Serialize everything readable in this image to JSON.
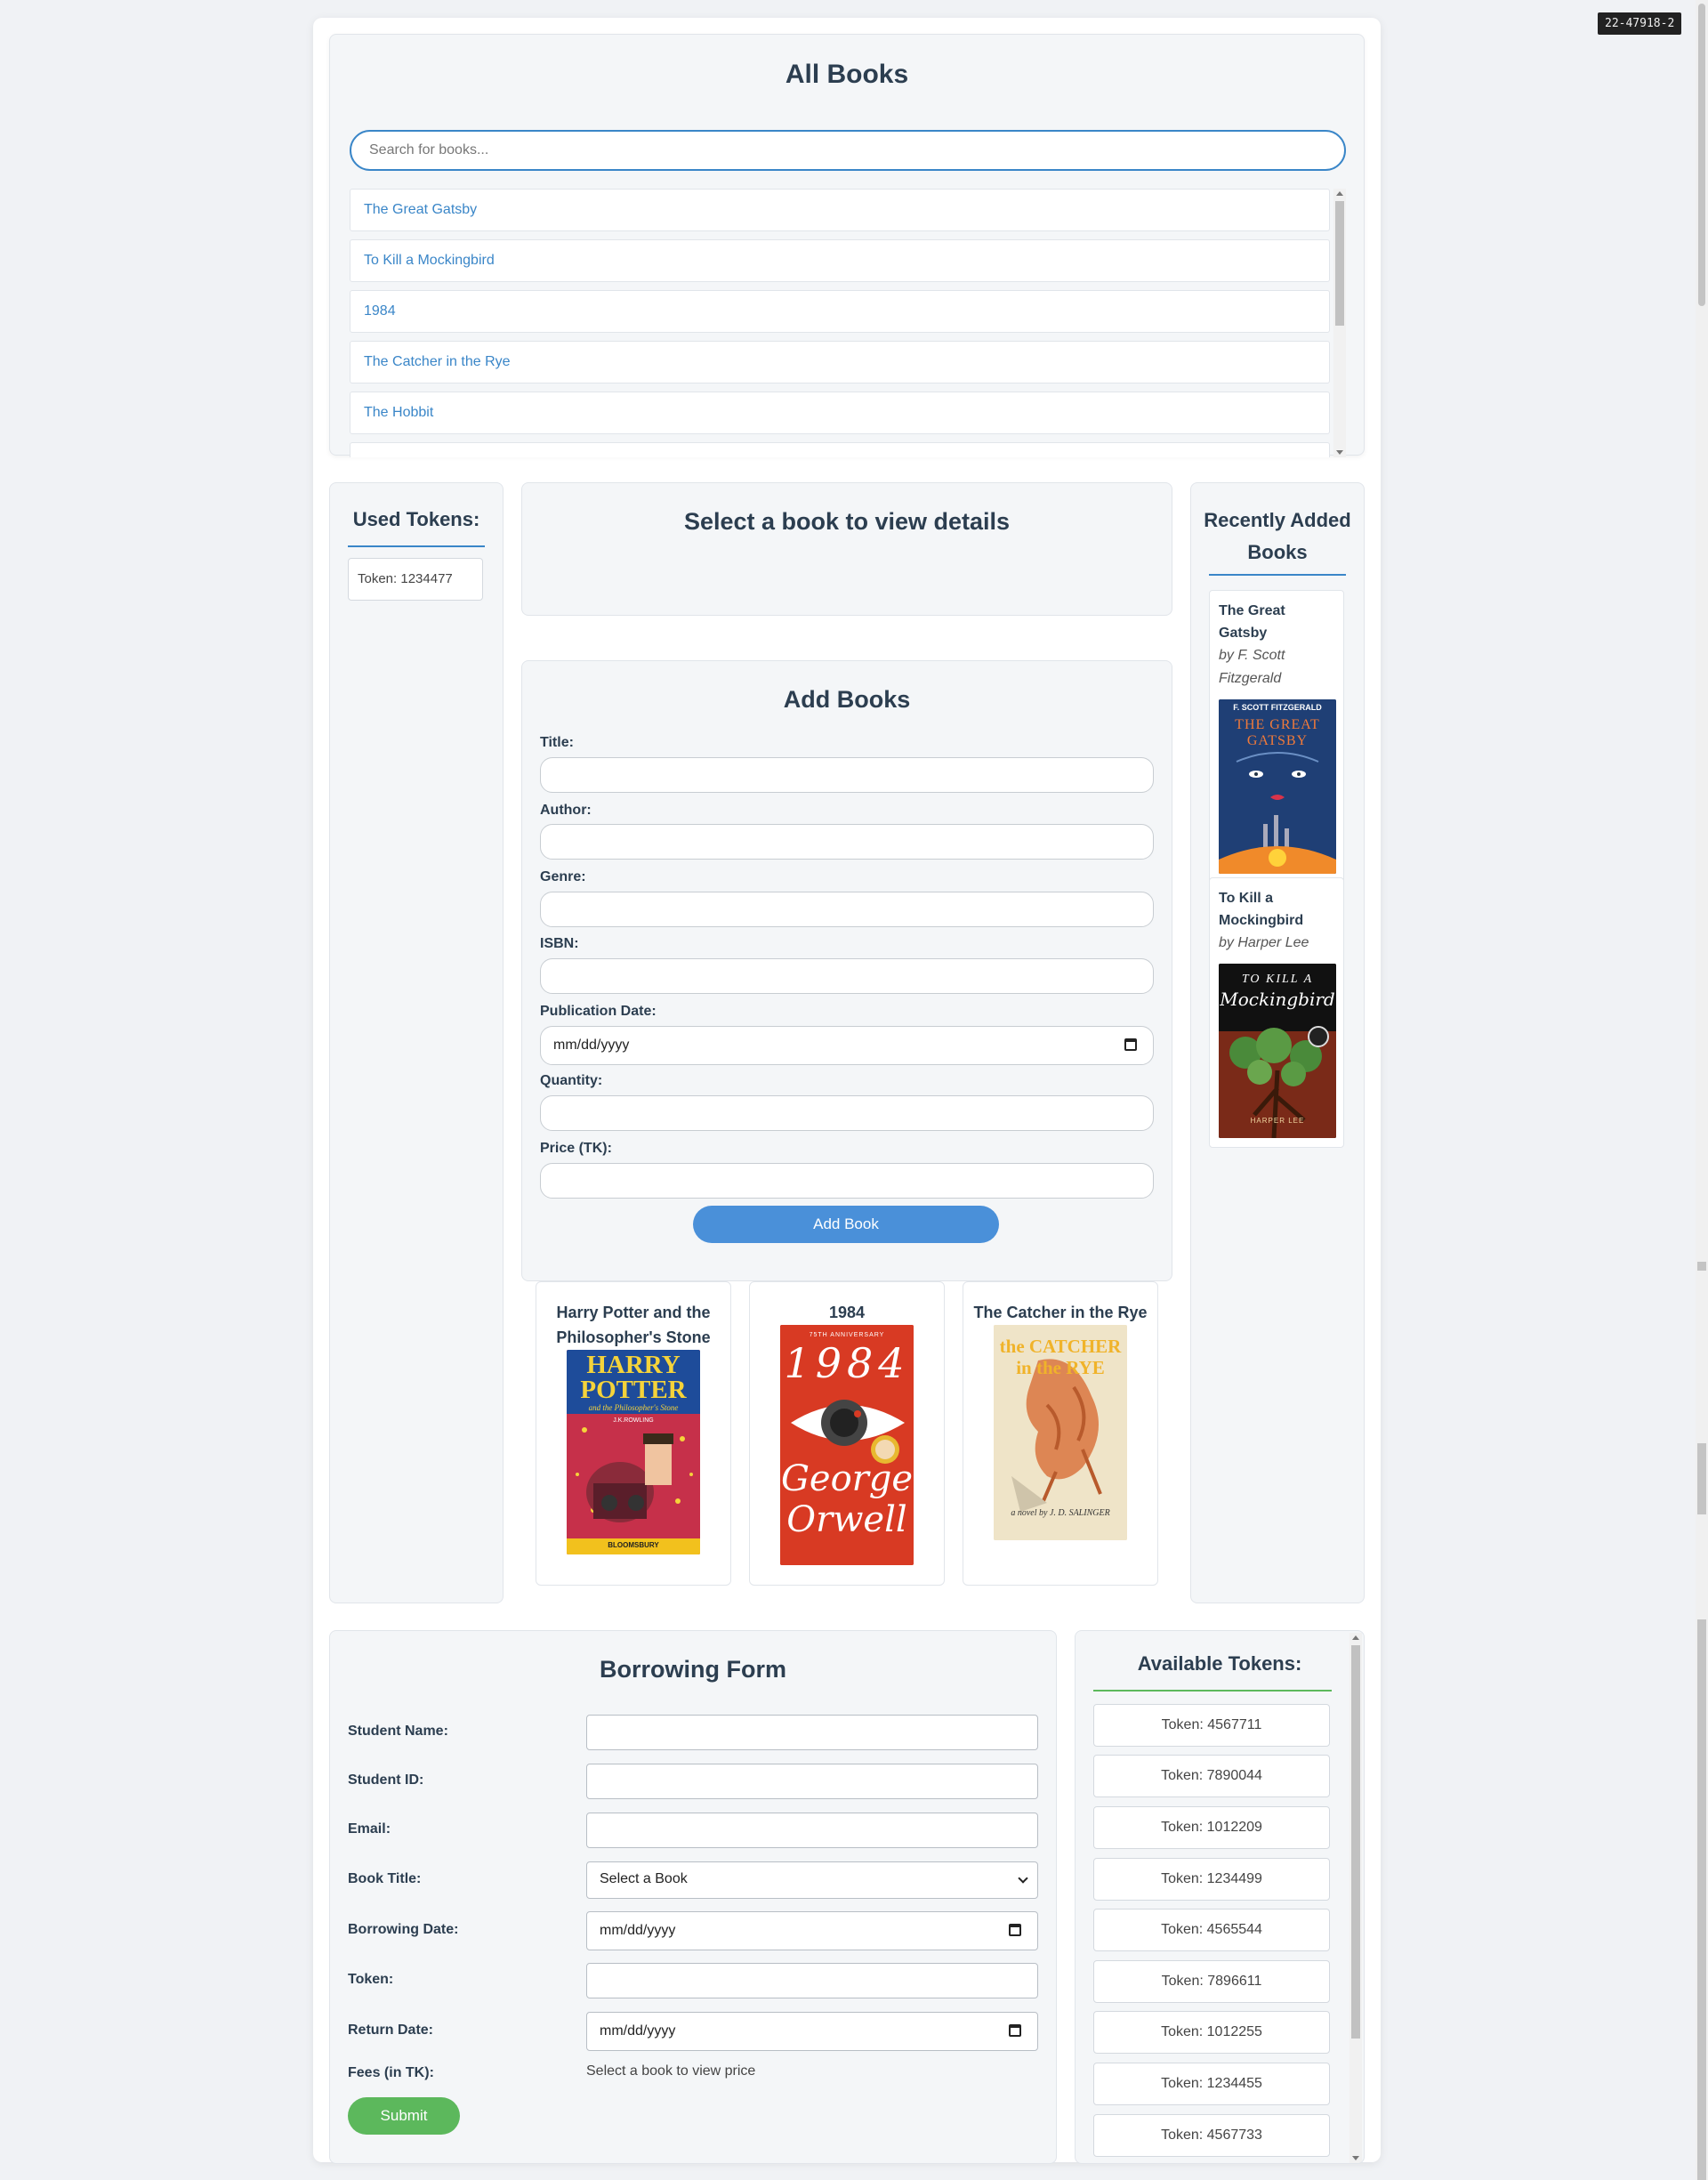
{
  "page_id": "22-47918-2",
  "all_books": {
    "title": "All Books",
    "search_placeholder": "Search for books...",
    "items": [
      "The Great Gatsby",
      "To Kill a Mockingbird",
      "1984",
      "The Catcher in the Rye",
      "The Hobbit"
    ]
  },
  "used_tokens": {
    "title": "Used Tokens:",
    "tokens": [
      "Token: 1234477"
    ]
  },
  "details": {
    "title": "Select a book to view details"
  },
  "add_books": {
    "title": "Add Books",
    "labels": {
      "title": "Title:",
      "author": "Author:",
      "genre": "Genre:",
      "isbn": "ISBN:",
      "publication_date": "Publication Date:",
      "quantity": "Quantity:",
      "price": "Price (TK):"
    },
    "date_placeholder": "mm/dd/yyyy",
    "button": "Add Book"
  },
  "featured": [
    {
      "title": "Harry Potter and the Philosopher's Stone",
      "cover": {
        "line1": "HARRY",
        "line2": "POTTER",
        "sub": "and the Philosopher's Stone",
        "author": "J.K.ROWLING",
        "publisher": "BLOOMSBURY"
      }
    },
    {
      "title": "1984",
      "cover": {
        "top": "75TH ANNIVERSARY",
        "number": "1984",
        "author1": "George",
        "author2": "Orwell"
      }
    },
    {
      "title": "The Catcher in the Rye",
      "cover": {
        "line1": "the CATCHER",
        "line2": "in the RYE",
        "byline": "a novel by J. D. SALINGER"
      }
    }
  ],
  "recent": {
    "title": "Recently Added Books",
    "books": [
      {
        "title": "The Great Gatsby",
        "author": "by F. Scott Fitzgerald",
        "cover_author": "F. SCOTT FITZGERALD",
        "cover_title1": "THE GREAT",
        "cover_title2": "GATSBY"
      },
      {
        "title": "To Kill a Mockingbird",
        "author": "by Harper Lee",
        "cover_title1": "TO KILL A",
        "cover_title2": "Mockingbird",
        "cover_author": "HARPER LEE"
      }
    ]
  },
  "borrowing": {
    "title": "Borrowing Form",
    "labels": {
      "student_name": "Student Name:",
      "student_id": "Student ID:",
      "email": "Email:",
      "book_title": "Book Title:",
      "borrowing_date": "Borrowing Date:",
      "token": "Token:",
      "return_date": "Return Date:",
      "fees": "Fees (in TK):"
    },
    "book_select": "Select a Book",
    "date_placeholder": "mm/dd/yyyy",
    "fees_text": "Select a book to view price",
    "submit": "Submit"
  },
  "available_tokens": {
    "title": "Available Tokens:",
    "tokens": [
      "Token: 4567711",
      "Token: 7890044",
      "Token: 1012209",
      "Token: 1234499",
      "Token: 4565544",
      "Token: 7896611",
      "Token: 1012255",
      "Token: 1234455",
      "Token: 4567733"
    ]
  },
  "colors": {
    "accent": "#3a86c8",
    "button_blue": "#4a90d9",
    "button_green": "#5cb85c",
    "text": "#2c3e50"
  }
}
